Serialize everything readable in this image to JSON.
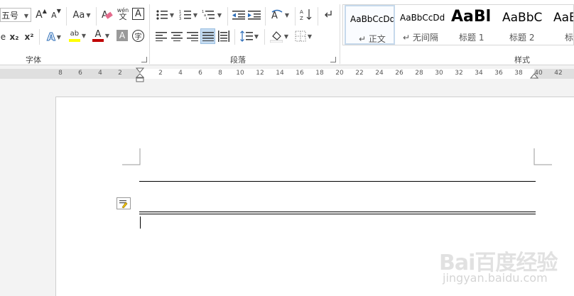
{
  "font_group": {
    "label": "字体",
    "font_size": "五号",
    "grow_font": "A",
    "shrink_font": "A",
    "change_case": "Aa",
    "clear_format": "A",
    "phonetic_top": "wén",
    "phonetic_bottom": "文",
    "char_border": "A",
    "subscript": "x₂",
    "superscript": "x²",
    "text_effect": "A",
    "highlight": "ab",
    "font_color": "A",
    "char_shading": "A",
    "enclose_char": "字",
    "strike_partial": "e"
  },
  "paragraph_group": {
    "label": "段落"
  },
  "styles_group": {
    "label": "样式",
    "items": [
      {
        "sample": "AaBbCcDd",
        "name": "↵ 正文"
      },
      {
        "sample": "AaBbCcDd",
        "name": "↵ 无间隔"
      },
      {
        "sample": "AaBl",
        "name": "标题 1"
      },
      {
        "sample": "AaBbC",
        "name": "标题 2"
      },
      {
        "sample": "AaE",
        "name": "标"
      }
    ]
  },
  "ruler": {
    "left_numbers": [
      "8",
      "6",
      "4",
      "2"
    ],
    "right_numbers": [
      "2",
      "4",
      "6",
      "8",
      "10",
      "12",
      "14",
      "16",
      "18",
      "20",
      "22",
      "24",
      "26",
      "28",
      "30",
      "32",
      "34",
      "36",
      "38",
      "40",
      "42"
    ]
  },
  "watermark": {
    "logo": "Bai百度经验",
    "url": "jingyan.baidu.com"
  },
  "colors": {
    "highlight": "#ffff00",
    "font_color": "#c00000",
    "accent": "#2b579a",
    "active_button": "#c5dcf2"
  }
}
